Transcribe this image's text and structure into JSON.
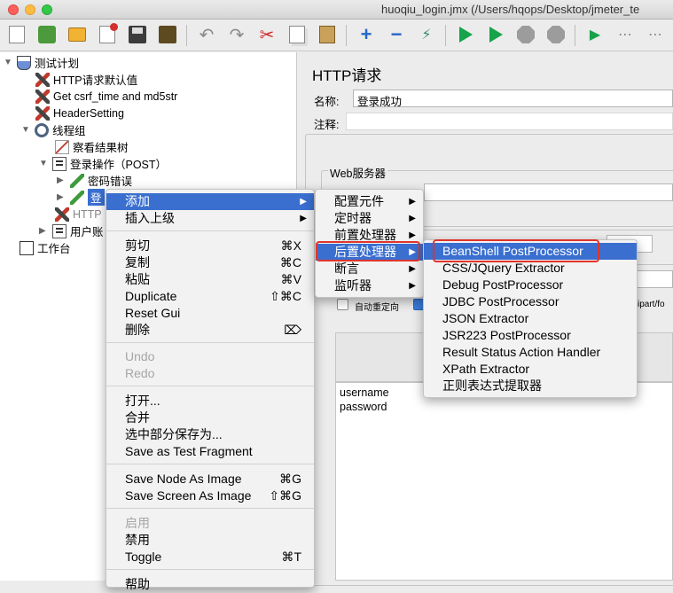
{
  "window": {
    "title": "huoqiu_login.jmx (/Users/hqops/Desktop/jmeter_te"
  },
  "toolbar": {
    "icons": [
      "new-icon",
      "template-icon",
      "open-icon",
      "close-icon",
      "save-icon",
      "edit-icon",
      "undo-icon",
      "redo-icon",
      "cut-icon",
      "copy-icon",
      "paste-icon",
      "expand-icon",
      "collapse-icon",
      "toggle-icon",
      "start-icon",
      "start-no-pause-icon",
      "stop-icon",
      "shutdown-icon",
      "remote-start-icon",
      "remote-icon",
      "remote-all-icon"
    ],
    "glyphs": {
      "undo": "↶",
      "redo": "↷",
      "cut": "✂",
      "plus": "+",
      "minus": "−",
      "toggle": "⚡",
      "remote": "▶",
      "dots": "⋯"
    }
  },
  "tree": {
    "twisty_open": "▼",
    "twisty_closed": "▶",
    "test_plan": "测试计划",
    "http_defaults": "HTTP请求默认值",
    "csrf": "Get csrf_time and md5str",
    "header": "HeaderSetting",
    "thread_group": "线程组",
    "result_tree": "察看结果树",
    "login_op": "登录操作（POST）",
    "pwd_error": "密码错误",
    "selected": "登",
    "http_partial": "HTTP",
    "user_partial": "用户账",
    "workbench": "工作台"
  },
  "panel": {
    "title": "HTTP请求",
    "name_label": "名称:",
    "name_value": "登录成功",
    "comment_label": "注释:",
    "web_server": "Web服务器",
    "auto_redirect": "自动重定向",
    "multipart_partial": "ltipart/fo",
    "params": [
      "username",
      "password"
    ]
  },
  "menu_main": {
    "items": [
      {
        "label": "添加",
        "arrow": "▶",
        "shortcut": "",
        "state": "highlight"
      },
      {
        "label": "插入上级",
        "arrow": "▶",
        "shortcut": "",
        "state": "normal"
      },
      {
        "label": "剪切",
        "shortcut": "⌘X",
        "state": "normal"
      },
      {
        "label": "复制",
        "shortcut": "⌘C",
        "state": "normal"
      },
      {
        "label": "粘贴",
        "shortcut": "⌘V",
        "state": "normal"
      },
      {
        "label": "Duplicate",
        "shortcut": "⇧⌘C",
        "state": "normal"
      },
      {
        "label": "Reset Gui",
        "shortcut": "",
        "state": "normal"
      },
      {
        "label": "删除",
        "shortcut": "⌦",
        "state": "normal"
      },
      {
        "label": "Undo",
        "shortcut": "",
        "state": "disabled"
      },
      {
        "label": "Redo",
        "shortcut": "",
        "state": "disabled"
      },
      {
        "label": "打开...",
        "shortcut": "",
        "state": "normal"
      },
      {
        "label": "合并",
        "shortcut": "",
        "state": "normal"
      },
      {
        "label": "选中部分保存为...",
        "shortcut": "",
        "state": "normal"
      },
      {
        "label": "Save as Test Fragment",
        "shortcut": "",
        "state": "normal"
      },
      {
        "label": "Save Node As Image",
        "shortcut": "⌘G",
        "state": "normal"
      },
      {
        "label": "Save Screen As Image",
        "shortcut": "⇧⌘G",
        "state": "normal"
      },
      {
        "label": "启用",
        "shortcut": "",
        "state": "disabled"
      },
      {
        "label": "禁用",
        "shortcut": "",
        "state": "normal"
      },
      {
        "label": "Toggle",
        "shortcut": "⌘T",
        "state": "normal"
      },
      {
        "label": "帮助",
        "shortcut": "",
        "state": "normal"
      }
    ]
  },
  "menu_add": {
    "items": [
      {
        "label": "配置元件",
        "arrow": "▶",
        "state": "normal"
      },
      {
        "label": "定时器",
        "arrow": "▶",
        "state": "normal"
      },
      {
        "label": "前置处理器",
        "arrow": "▶",
        "state": "normal"
      },
      {
        "label": "后置处理器",
        "arrow": "▶",
        "state": "highlight"
      },
      {
        "label": "断言",
        "arrow": "▶",
        "state": "normal"
      },
      {
        "label": "监听器",
        "arrow": "▶",
        "state": "normal"
      }
    ]
  },
  "menu_post": {
    "items": [
      {
        "label": "BeanShell PostProcessor",
        "state": "highlight"
      },
      {
        "label": "CSS/JQuery Extractor",
        "state": "normal"
      },
      {
        "label": "Debug PostProcessor",
        "state": "normal"
      },
      {
        "label": "JDBC PostProcessor",
        "state": "normal"
      },
      {
        "label": "JSON Extractor",
        "state": "normal"
      },
      {
        "label": "JSR223 PostProcessor",
        "state": "normal"
      },
      {
        "label": "Result Status Action Handler",
        "state": "normal"
      },
      {
        "label": "XPath Extractor",
        "state": "normal"
      },
      {
        "label": "正则表达式提取器",
        "state": "normal"
      }
    ]
  },
  "colors": {
    "highlight": "#3a6fd0",
    "annotation": "#e0342a"
  }
}
